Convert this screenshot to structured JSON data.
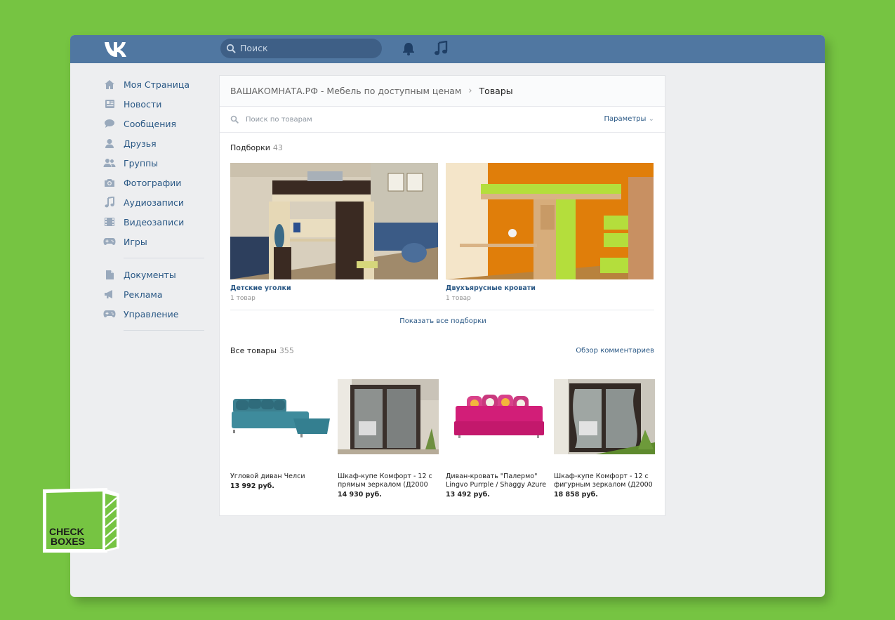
{
  "topbar": {
    "logo": "vk-logo",
    "search_placeholder": "Поиск",
    "icons": [
      "bell-icon",
      "music-icon"
    ]
  },
  "sidebar": {
    "items": [
      {
        "label": "Моя Страница",
        "icon": "home-icon"
      },
      {
        "label": "Новости",
        "icon": "news-icon"
      },
      {
        "label": "Сообщения",
        "icon": "messages-icon"
      },
      {
        "label": "Друзья",
        "icon": "friend-icon"
      },
      {
        "label": "Группы",
        "icon": "groups-icon"
      },
      {
        "label": "Фотографии",
        "icon": "camera-icon"
      },
      {
        "label": "Аудиозаписи",
        "icon": "music-note-icon"
      },
      {
        "label": "Видеозаписи",
        "icon": "film-icon"
      },
      {
        "label": "Игры",
        "icon": "gamepad-icon"
      }
    ],
    "secondary": [
      {
        "label": "Документы",
        "icon": "document-icon"
      },
      {
        "label": "Реклама",
        "icon": "megaphone-icon"
      },
      {
        "label": "Управление",
        "icon": "gamepad-icon"
      }
    ]
  },
  "breadcrumb": {
    "group": "ВАШАКОМНАТА.РФ - Мебель по доступным ценам",
    "current": "Товары"
  },
  "product_search": {
    "placeholder": "Поиск по товарам",
    "params_label": "Параметры"
  },
  "collections": {
    "title": "Подборки",
    "count": "43",
    "items": [
      {
        "title": "Детские уголки",
        "subtitle": "1 товар"
      },
      {
        "title": "Двухъярусные кровати",
        "subtitle": "1 товар"
      }
    ],
    "show_all": "Показать все подборки"
  },
  "products": {
    "title": "Все товары",
    "count": "355",
    "review_link": "Обзор комментариев",
    "items": [
      {
        "name": "Угловой диван Челси",
        "price": "13 992 руб."
      },
      {
        "name": "Шкаф-купе Комфорт - 12 с прямым зеркалом (Д2000 х...",
        "price": "14 930 руб."
      },
      {
        "name": "Диван-кровать \"Палермо\" Lingvo Purrple / Shaggy Azure",
        "price": "13 492 руб."
      },
      {
        "name": "Шкаф-купе Комфорт - 12 с фигурным зеркалом (Д2000 ...",
        "price": "18 858 руб."
      }
    ]
  },
  "brand": {
    "line1": "CHECK",
    "line2": "BOXES"
  },
  "colors": {
    "page_bg": "#76c442",
    "header": "#5077a1",
    "link": "#2a5885"
  }
}
